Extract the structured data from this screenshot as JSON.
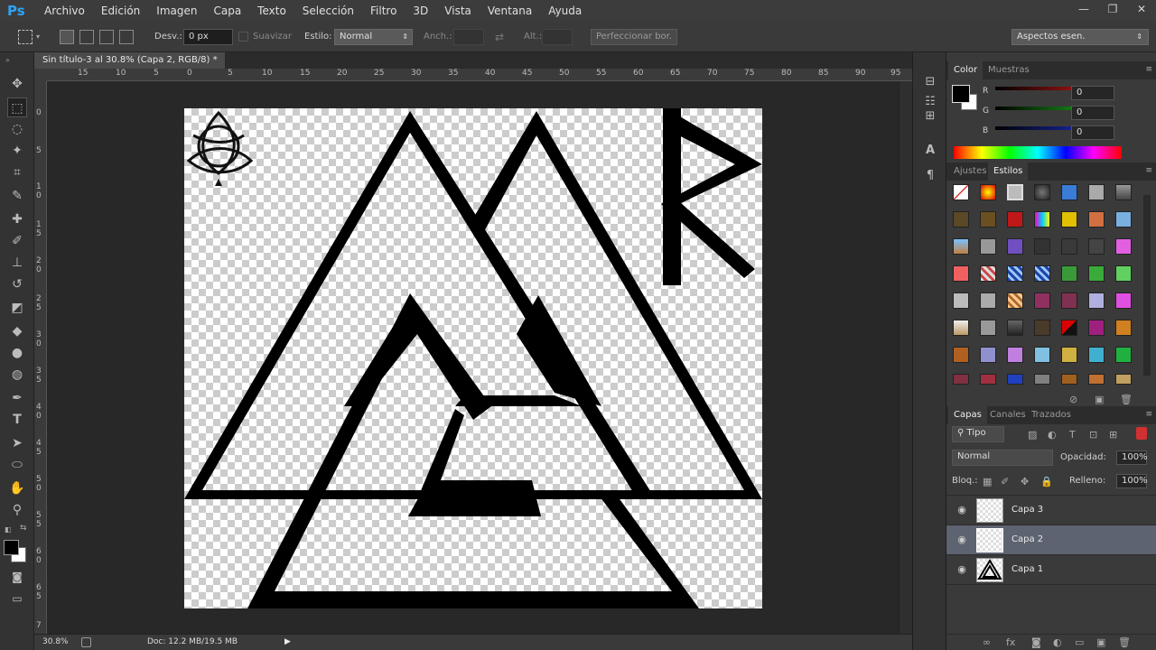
{
  "app": {
    "logo": "Ps"
  },
  "menu": [
    "Archivo",
    "Edición",
    "Imagen",
    "Capa",
    "Texto",
    "Selección",
    "Filtro",
    "3D",
    "Vista",
    "Ventana",
    "Ayuda"
  ],
  "window_controls": [
    "—",
    "❐",
    "✕"
  ],
  "options": {
    "feather_label": "Desv.:",
    "feather_value": "0 px",
    "antialias_label": "Suavizar",
    "style_label": "Estilo:",
    "style_value": "Normal",
    "width_label": "Anch.:",
    "height_label": "Alt.:",
    "refine_label": "Perfeccionar bor.",
    "workspace": "Aspectos esen."
  },
  "document": {
    "tab_title": "Sin título-3 al 30.8% (Capa 2, RGB/8) *",
    "tab_close": "×",
    "ruler_h": [
      "15",
      "10",
      "5",
      "0",
      "5",
      "10",
      "15",
      "20",
      "25",
      "30",
      "35",
      "40",
      "45",
      "50",
      "55",
      "60",
      "65",
      "70",
      "75",
      "80",
      "85",
      "90",
      "95"
    ],
    "ruler_v": [
      "0",
      "5",
      "1 0",
      "1 5",
      "2 0",
      "2 5",
      "3 0",
      "3 5",
      "4 0",
      "4 5",
      "5 0",
      "5 5",
      "6 0",
      "6 5",
      "7"
    ]
  },
  "status": {
    "zoom": "30.8%",
    "doc": "Doc: 12.2 MB/19.5 MB"
  },
  "color_panel": {
    "tabs": [
      "Color",
      "Muestras"
    ],
    "channels": [
      {
        "label": "R",
        "value": "0",
        "color": "#d01818"
      },
      {
        "label": "G",
        "value": "0",
        "color": "#1eb01e"
      },
      {
        "label": "B",
        "value": "0",
        "color": "#1e32d0"
      }
    ]
  },
  "styles_panel": {
    "tabs": [
      "Ajustes",
      "Estilos"
    ]
  },
  "layers_panel": {
    "tabs": [
      "Capas",
      "Canales",
      "Trazados"
    ],
    "filter": "Tipo",
    "blend_mode": "Normal",
    "opacity_label": "Opacidad:",
    "opacity_value": "100%",
    "lock_label": "Bloq.:",
    "fill_label": "Relleno:",
    "fill_value": "100%",
    "layers": [
      {
        "name": "Capa 3",
        "selected": false
      },
      {
        "name": "Capa 2",
        "selected": true
      },
      {
        "name": "Capa 1",
        "selected": false
      }
    ]
  }
}
